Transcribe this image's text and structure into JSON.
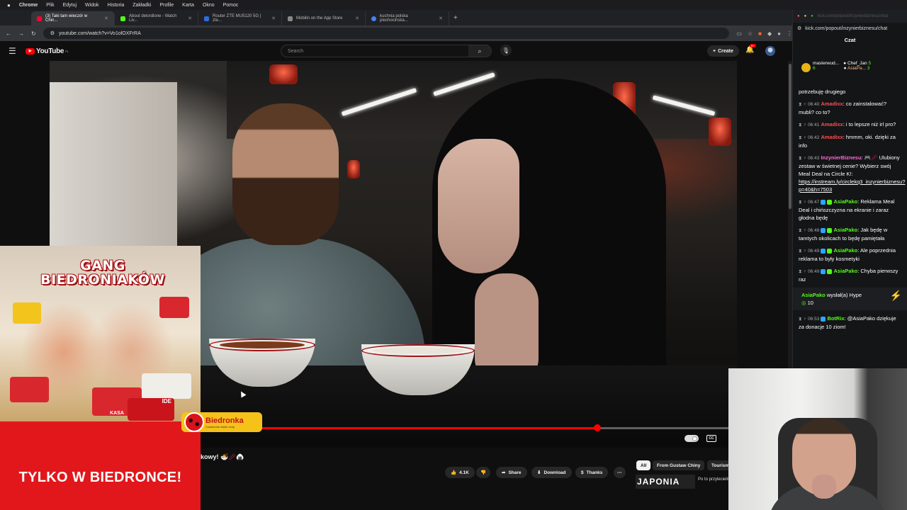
{
  "menubar": {
    "apple": "",
    "app": "Chrome",
    "items": [
      "Plik",
      "Edytuj",
      "Widok",
      "Historia",
      "Zakładki",
      "Profile",
      "Karta",
      "Okno",
      "Pomoc"
    ]
  },
  "tabs": [
    {
      "title": "(3) Taki tam wieczór w Chin...",
      "favicon_color": "#ff0033",
      "active": true
    },
    {
      "title": "About delordione - Watch Liv...",
      "favicon_color": "#53fc18",
      "active": false
    },
    {
      "title": "Router ZTE MU5120 5G | zte...",
      "favicon_color": "#2a6fdb",
      "active": false
    },
    {
      "title": "Mobilin on the App Store",
      "favicon_color": "#888888",
      "active": false
    },
    {
      "title": "kuchnia polska piechocinska...",
      "favicon_color": "#4285f4",
      "active": false
    }
  ],
  "address": {
    "url": "youtube.com/watch?v=Vo1olOXFrRA"
  },
  "youtube": {
    "logo_text": "YouTube",
    "logo_region": "PL",
    "search_placeholder": "Search",
    "create_label": "Create",
    "notif_count": "9+"
  },
  "video": {
    "progress_fraction": 0.74,
    "title_fragment": "kowy! 🍜🥢🍙"
  },
  "ad": {
    "title_line1": "GANG",
    "title_line2": "BIEDRONIAKÓW",
    "tagline": "TYLKO W BIEDRONCE!",
    "brand": "Biedronka",
    "brand_sub": "Codziennie niskie ceny",
    "toy_label1": "KASA",
    "toy_label2": "IDE"
  },
  "actions": {
    "likes": "4.1K",
    "share": "Share",
    "download": "Download",
    "thanks": "Thanks",
    "more": "⋯"
  },
  "chips": [
    "All",
    "From Gustaw Chiny",
    "Tourism"
  ],
  "sidebar_thumb": {
    "text": "JAPONIA",
    "caption": "Po to przylecieliśmy"
  },
  "chat": {
    "window_url": "kick.com/popout/inzynierbiznesu/chat",
    "window_title": "kick.com/popout/inzynierbiznesu/chat",
    "heading": "Czat",
    "pinned": {
      "user1": "masterwud...",
      "user1_count": "6",
      "user2": "Chef_Jan",
      "user2_count": "5",
      "user3": "AsiaPa...",
      "user3_count": "3"
    },
    "messages": [
      {
        "time": "",
        "user": "",
        "text": "potrzebuję drugiego"
      },
      {
        "time": "06:40",
        "user": "Amadixx",
        "color": "red",
        "text": ": co zainstalować? mubli? co to?"
      },
      {
        "time": "06:41",
        "user": "Amadixx",
        "color": "red",
        "text": ": i to lepsze niż irl pro?"
      },
      {
        "time": "06:42",
        "user": "Amadixx",
        "color": "red",
        "text": ": hmmm, oki. dzięki za info"
      },
      {
        "time": "06:43",
        "user": "InzynierBiznesu",
        "color": "pink",
        "text": ": 🎮🥢 Ulubiony zestaw w świetnej cenie? Wybierz swój Meal Deal na Circle K!: ",
        "link": "https://instream.ly/circlekq3_inzynierbiznesu?p=40&h=7503"
      },
      {
        "time": "06:47",
        "user": "AsiaPako",
        "color": "green",
        "text": ": Reklama Meal Deal i chińszczyzna na ekranie i zaraz głodna będę"
      },
      {
        "time": "06:48",
        "user": "AsiaPako",
        "color": "green",
        "text": ": Jak będę w tamtych okolicach to będę pamiętała"
      },
      {
        "time": "06:49",
        "user": "AsiaPako",
        "color": "green",
        "text": ": Ale poprzednia reklama to były kosmetyki"
      },
      {
        "time": "06:49",
        "user": "AsiaPako",
        "color": "green",
        "text": ": Chyba pierwszy raz"
      }
    ],
    "hype": {
      "user": "AsiaPako",
      "text": "wysłał(a) Hype",
      "amount": "10"
    },
    "last": {
      "time": "06:53",
      "user": "BotRix",
      "text": ": @AsiaPako dziękuje za donacje 10 ziom!"
    }
  }
}
